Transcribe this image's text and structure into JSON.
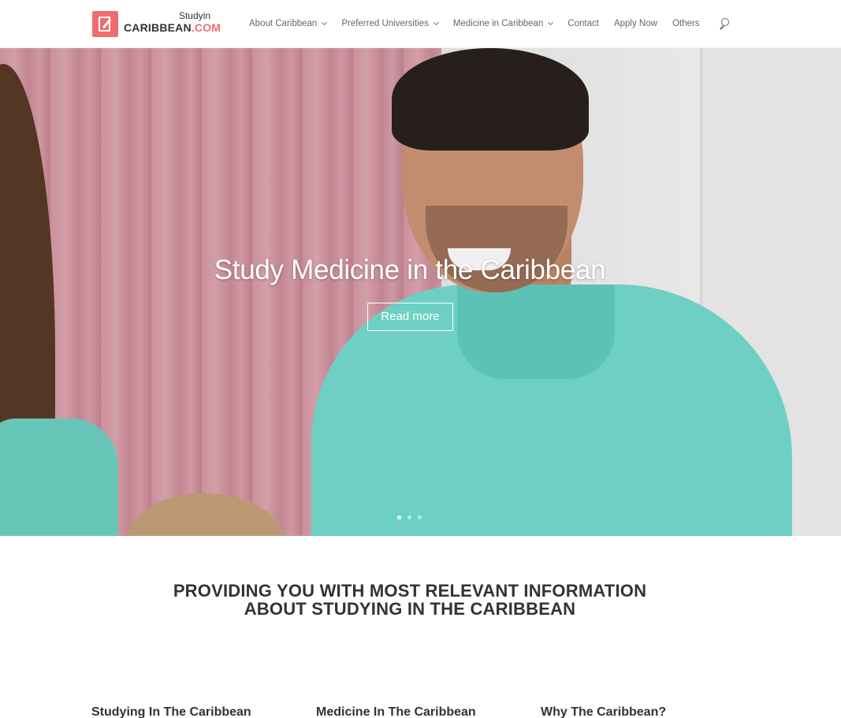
{
  "header": {
    "logo": {
      "small_text": "Studyin",
      "brand_main": "CARIBBEAN",
      "brand_suffix": ".COM"
    },
    "nav": [
      {
        "label": "About Caribbean",
        "has_dropdown": true
      },
      {
        "label": "Preferred Universities",
        "has_dropdown": true
      },
      {
        "label": "Medicine in Caribbean",
        "has_dropdown": true
      },
      {
        "label": "Contact",
        "has_dropdown": false
      },
      {
        "label": "Apply Now",
        "has_dropdown": false
      },
      {
        "label": "Others",
        "has_dropdown": false
      }
    ],
    "search_icon": "search-icon"
  },
  "hero": {
    "title": "Study Medicine in the Caribbean",
    "button_label": "Read more",
    "slides_count": 3,
    "active_slide": 1
  },
  "intro": {
    "line1": "PROVIDING YOU WITH MOST RELEVANT INFORMATION",
    "line2": "ABOUT STUDYING IN THE CARIBBEAN"
  },
  "columns": [
    {
      "title": "Studying In The Caribbean"
    },
    {
      "title": "Medicine In The Caribbean"
    },
    {
      "title": "Why The Caribbean?"
    }
  ],
  "colors": {
    "accent": "#ee6d6f",
    "nav_text": "#666666",
    "heading_text": "#333333"
  }
}
